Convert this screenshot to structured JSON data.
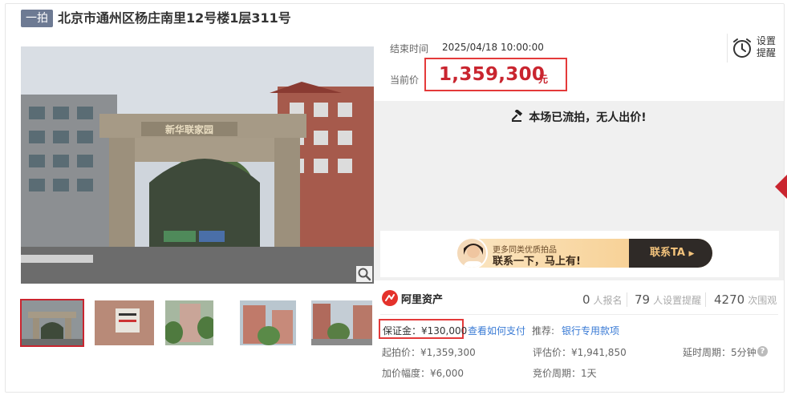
{
  "header": {
    "tag": "一拍",
    "title": "北京市通州区杨庄南里12号楼1层311号"
  },
  "gallery": {
    "thumbnails": [
      "thumb-1",
      "thumb-2",
      "thumb-3",
      "thumb-4",
      "thumb-5"
    ],
    "active_index": 0,
    "zoom_icon": "magnifier-icon",
    "gate_sign": "新华联家园"
  },
  "auction": {
    "end_time_label": "结束时间",
    "end_time": "2025/04/18 10:00:00",
    "current_price_label": "当前价",
    "current_price": "1,359,300",
    "price_unit": "元",
    "remind_label": "设置提醒",
    "status_message": "本场已流拍，无人出价!"
  },
  "banner": {
    "small_text": "更多同类优质拍品",
    "main_text": "联系一下，马上有!",
    "cta": "联系TA"
  },
  "brand": {
    "name": "阿里资产"
  },
  "stats": [
    {
      "count": "0",
      "label": "人报名"
    },
    {
      "count": "79",
      "label": "人设置提醒"
    },
    {
      "count": "4270",
      "label": "次围观"
    }
  ],
  "details": {
    "deposit": "保证金：¥130,000",
    "how_to_pay": "查看如何支付",
    "recommend_label": "推荐:",
    "recommend_link": "银行专用款项",
    "start_price": "起拍价：¥1,359,300",
    "eval_price": "评估价：¥1,941,850",
    "delay_period": "延时周期：5分钟",
    "increment": "加价幅度：¥6,000",
    "bid_cycle": "竞价周期：1天"
  },
  "colors": {
    "accent_red": "#c9252f",
    "box_red": "#e43a3a",
    "link_blue": "#3a7bd5",
    "tag_gray": "#6d7a93"
  }
}
